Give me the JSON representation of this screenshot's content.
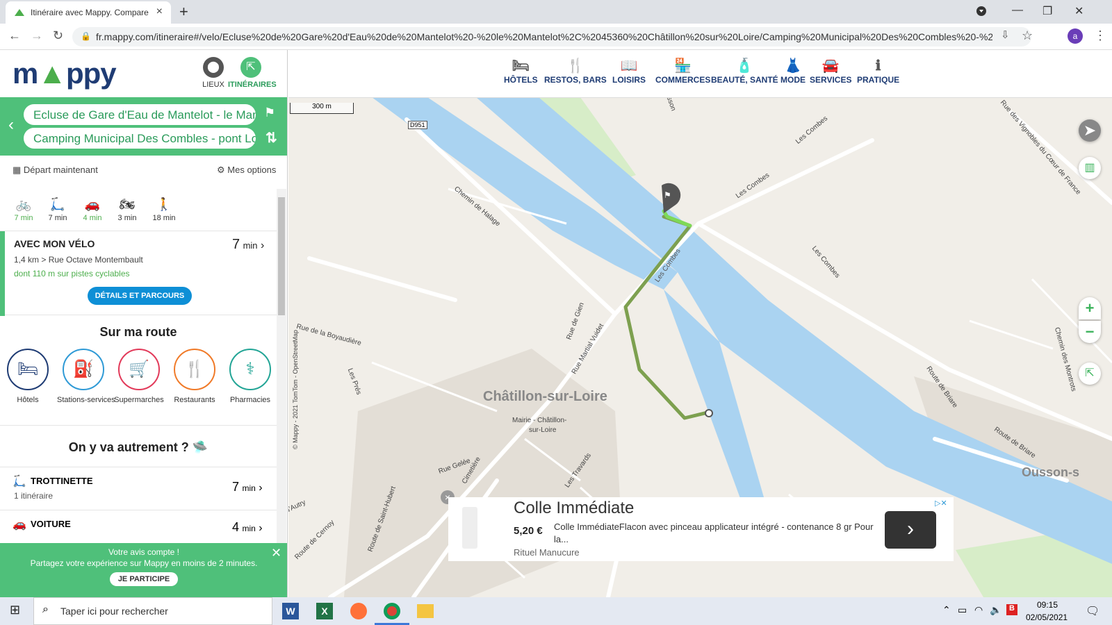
{
  "browser": {
    "tab_title": "Itinéraire avec Mappy. Compare:",
    "url": "fr.mappy.com/itineraire#/velo/Ecluse%20de%20Gare%20d'Eau%20de%20Mantelot%20-%20le%20Mantelot%2C%2045360%20Châtillon%20sur%20Loire/Camping%20Municipal%20Des%20Combles%20-%20pon...",
    "avatar": "a"
  },
  "header": {
    "logo_m": "m",
    "logo_rest": "ppy",
    "lieux": "LIEUX",
    "itineraires": "ITINÉRAIRES"
  },
  "route": {
    "from": "Ecluse de Gare d'Eau de Mantelot - le Mantelo",
    "to": "Camping Municipal Des Combles - pont Loire,"
  },
  "departure": "Départ maintenant",
  "options": "Mes options",
  "modes": [
    {
      "name": "velo",
      "time": "7 min",
      "color": "#4cae4c"
    },
    {
      "name": "trottinette",
      "time": "7 min",
      "color": "#333"
    },
    {
      "name": "voiture",
      "time": "4 min",
      "color": "#4cae4c"
    },
    {
      "name": "moto",
      "time": "3 min",
      "color": "#333"
    },
    {
      "name": "pieton",
      "time": "18 min",
      "color": "#333"
    }
  ],
  "result": {
    "title": "AVEC MON VÉLO",
    "time_value": "7",
    "time_unit": "min",
    "detail": "1,4 km > Rue Octave Montembault",
    "bike_lanes": "dont 110 m sur pistes cyclables",
    "button": "DÉTAILS ET PARCOURS"
  },
  "on_route": {
    "title": "Sur ma route",
    "items": [
      "Hôtels",
      "Stations-services",
      "Supermarches",
      "Restaurants",
      "Pharmacies"
    ]
  },
  "alternatives": {
    "title": "On y va autrement ?",
    "items": [
      {
        "title": "TROTTINETTE",
        "sub": "1 itinéraire",
        "time_value": "7",
        "time_unit": "min"
      },
      {
        "title": "VOITURE",
        "sub": "",
        "time_value": "4",
        "time_unit": "min"
      }
    ]
  },
  "survey": {
    "line1": "Votre avis compte !",
    "line2": "Partagez votre expérience sur Mappy en moins de 2 minutes.",
    "button": "JE PARTICIPE"
  },
  "categories": [
    "HÔTELS",
    "RESTOS, BARS",
    "LOISIRS",
    "COMMERCES",
    "BEAUTÉ, SANTÉ",
    "MODE",
    "SERVICES",
    "PRATIQUE"
  ],
  "map": {
    "scale": "300 m",
    "copyright": "© Mappy - 2021 TomTom - OpenStreetMap",
    "labels": {
      "town": "Châtillon-sur-Loire",
      "mairie": "Mairie - Châtillon-",
      "mairie2": "sur-Loire",
      "d951": "D951",
      "chemin_halage": "Chemin de Halage",
      "les_combes1": "Les Combes",
      "les_combes2": "Les Combes",
      "les_combes3": "Les Combes",
      "les_combes4": "Les Combes",
      "vignobles": "Rue des Vignobles du Cœur de France",
      "rue_gien": "Rue de Gien",
      "martial": "Rue Martial Vuidet",
      "boyaudiere": "Rue de la Boyaudière",
      "les_pres": "Les Prés",
      "route_briare1": "Route de Briare",
      "route_briare2": "Route de Briare",
      "montrots": "Chemin des Montrots",
      "ousson": "Ousson-s",
      "gelee": "Rue Gelée",
      "cimetiere": "Cimetière",
      "travards": "Les Travards",
      "saint_hubert": "Route de Saint-Hubert",
      "cernoy": "Route de Cernoy",
      "autry": "d'Autry",
      "ousson_top": "sson"
    }
  },
  "ad": {
    "title": "Colle Immédiate",
    "price": "5,20 €",
    "description": "Colle ImmédiateFlacon avec pinceau applicateur intégré - contenance 8 gr Pour la...",
    "brand": "Rituel Manucure"
  },
  "taskbar": {
    "search_placeholder": "Taper ici pour rechercher",
    "time": "09:15",
    "date": "02/05/2021"
  }
}
